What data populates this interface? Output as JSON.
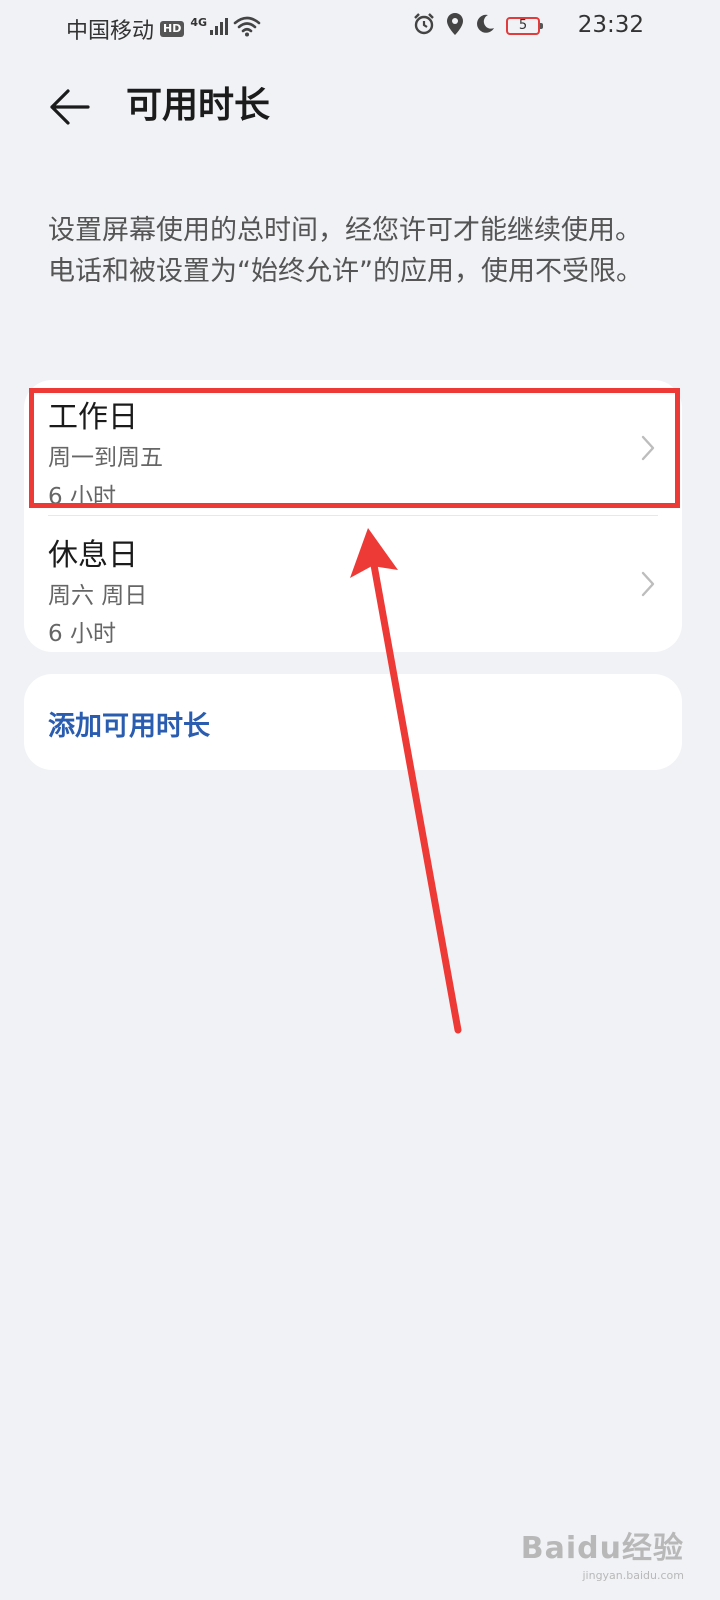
{
  "status_bar": {
    "carrier": "中国移动",
    "hd_badge": "HD",
    "network": "4G",
    "battery_level": "5",
    "time": "23:32",
    "icons": [
      "signal-icon",
      "wifi-icon",
      "alarm-icon",
      "location-icon",
      "moon-icon",
      "battery-icon"
    ]
  },
  "header": {
    "back_icon": "arrow-left-icon",
    "title": "可用时长"
  },
  "description": "设置屏幕使用的总时间，经您许可才能继续使用。电话和被设置为“始终允许”的应用，使用不受限。",
  "schedules": [
    {
      "title": "工作日",
      "days": "周一到周五",
      "duration": "6 小时"
    },
    {
      "title": "休息日",
      "days": "周六 周日",
      "duration": "6 小时"
    }
  ],
  "add_button": {
    "label": "添加可用时长"
  },
  "annotation": {
    "highlight_color": "#ee3a37",
    "arrow_color": "#ee3a37"
  },
  "watermark": {
    "logo": "Baidu经验",
    "sub": "jingyan.baidu.com"
  },
  "colors": {
    "background": "#f1f2f5",
    "card": "#ffffff",
    "accent": "#2a5db0"
  }
}
